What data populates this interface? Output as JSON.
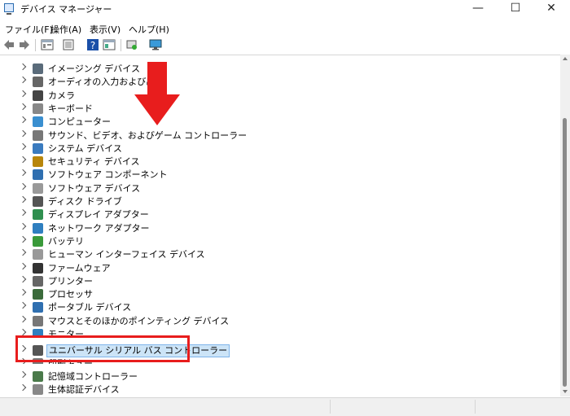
{
  "window": {
    "title": "デバイス マネージャー",
    "minimize_glyph": "—",
    "maximize_glyph": "☐",
    "close_glyph": "✕"
  },
  "menu": [
    "ファイル(F)",
    "操作(A)",
    "表示(V)",
    "ヘルプ(H)"
  ],
  "toolbar": [
    "back-icon",
    "forward-icon",
    "properties-icon",
    "driver-icon",
    "help-icon",
    "view-icon",
    "scan-hardware-icon",
    "monitor-icon"
  ],
  "devices": [
    {
      "label": "イメージング デバイス",
      "icon": "camera-icon"
    },
    {
      "label": "オーディオの入力および出力",
      "icon": "speaker-icon"
    },
    {
      "label": "カメラ",
      "icon": "webcam-icon"
    },
    {
      "label": "キーボード",
      "icon": "keyboard-icon"
    },
    {
      "label": "コンピューター",
      "icon": "computer-icon"
    },
    {
      "label": "サウンド、ビデオ、およびゲーム コントローラー",
      "icon": "sound-icon"
    },
    {
      "label": "システム デバイス",
      "icon": "system-icon"
    },
    {
      "label": "セキュリティ デバイス",
      "icon": "security-icon"
    },
    {
      "label": "ソフトウェア コンポーネント",
      "icon": "component-icon"
    },
    {
      "label": "ソフトウェア デバイス",
      "icon": "software-device-icon"
    },
    {
      "label": "ディスク ドライブ",
      "icon": "disk-icon"
    },
    {
      "label": "ディスプレイ アダプター",
      "icon": "display-adapter-icon"
    },
    {
      "label": "ネットワーク アダプター",
      "icon": "network-icon"
    },
    {
      "label": "バッテリ",
      "icon": "battery-icon"
    },
    {
      "label": "ヒューマン インターフェイス デバイス",
      "icon": "hid-icon"
    },
    {
      "label": "ファームウェア",
      "icon": "firmware-icon"
    },
    {
      "label": "プリンター",
      "icon": "printer-icon"
    },
    {
      "label": "プロセッサ",
      "icon": "processor-icon"
    },
    {
      "label": "ポータブル デバイス",
      "icon": "portable-icon"
    },
    {
      "label": "マウスとそのほかのポインティング デバイス",
      "icon": "mouse-icon"
    },
    {
      "label": "モニター",
      "icon": "monitor-device-icon"
    },
    {
      "label": "ユニバーサル シリアル バス コントローラー",
      "icon": "usb-icon"
    },
    {
      "label": "印刷キュー",
      "icon": "print-queue-icon"
    },
    {
      "label": "記憶域コントローラー",
      "icon": "storage-icon"
    },
    {
      "label": "生体認証デバイス",
      "icon": "biometric-icon"
    }
  ],
  "selected_device": "ユニバーサル シリアル バス コントローラー",
  "colors": {
    "highlight_box": "#e81d1d",
    "arrow": "#e81d1d",
    "selection": "#cce4f7"
  }
}
